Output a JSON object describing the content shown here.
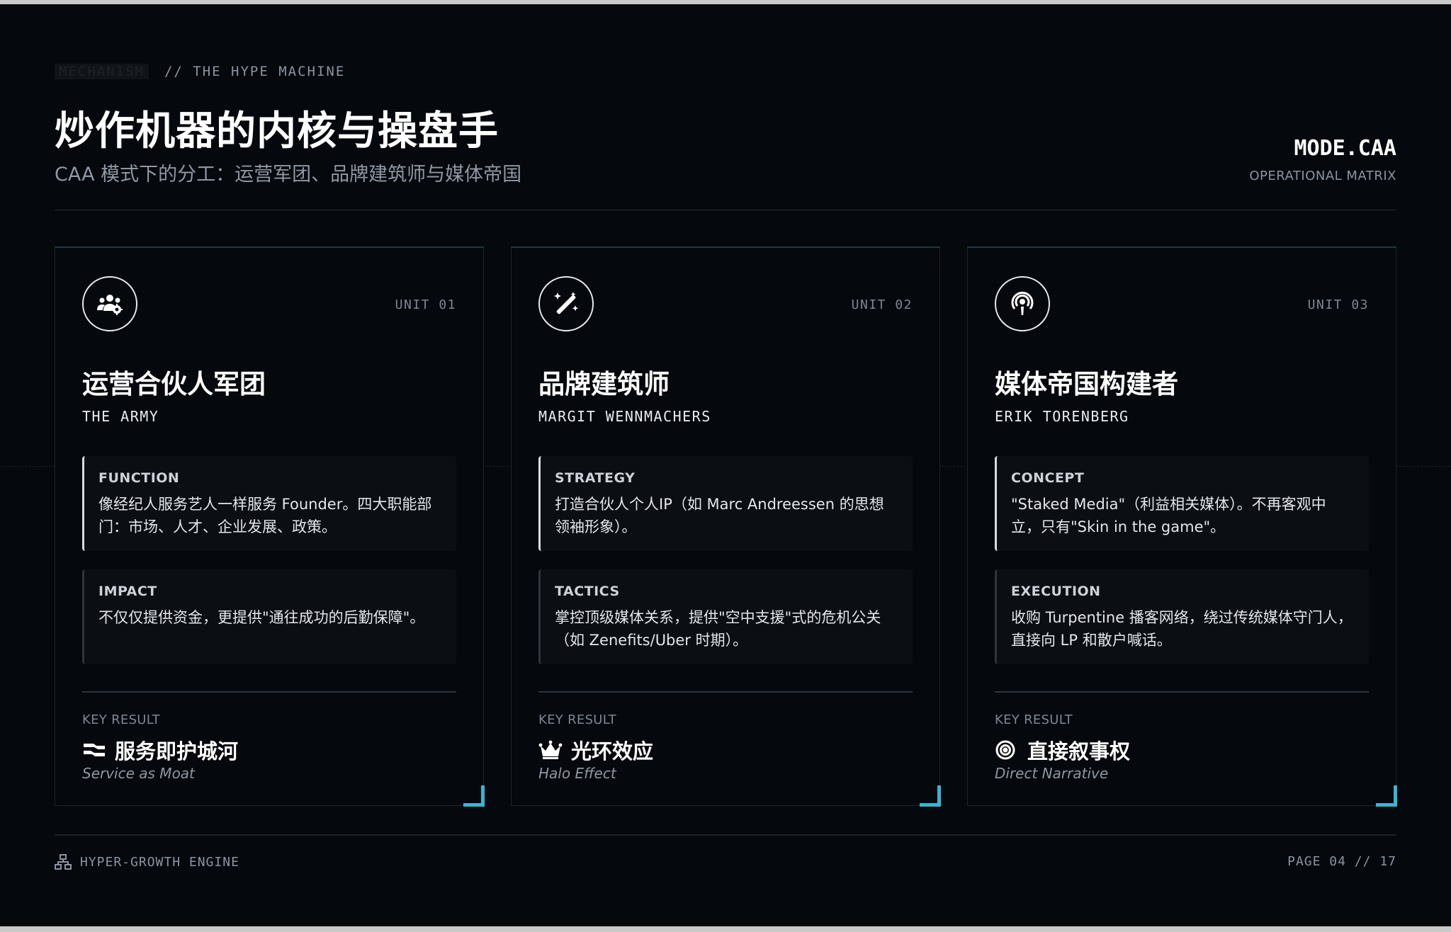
{
  "header": {
    "tag": "MECHANISM",
    "eyebrow": "// THE HYPE MACHINE",
    "title": "炒作机器的内核与操盘手",
    "subtitle": "CAA 模式下的分工：运营军团、品牌建筑师与媒体帝国",
    "mode": "MODE.CAA",
    "mode_sub": "OPERATIONAL MATRIX"
  },
  "cards": [
    {
      "icon": "users-gear-icon",
      "unit": "UNIT 01",
      "title": "运营合伙人军团",
      "subtitle": "THE ARMY",
      "blocks": [
        {
          "label": "FUNCTION",
          "text": "像经纪人服务艺人一样服务 Founder。四大职能部门：市场、人才、企业发展、政策。"
        },
        {
          "label": "IMPACT",
          "text": "不仅仅提供资金，更提供\"通往成功的后勤保障\"。"
        }
      ],
      "kr_label": "KEY RESULT",
      "kr_icon": "handshake-icon",
      "kr_title": "服务即护城河",
      "kr_en": "Service as Moat"
    },
    {
      "icon": "magic-wand-icon",
      "unit": "UNIT 02",
      "title": "品牌建筑师",
      "subtitle": "MARGIT WENNMACHERS",
      "blocks": [
        {
          "label": "STRATEGY",
          "text": "打造合伙人个人IP（如 Marc Andreessen 的思想领袖形象）。"
        },
        {
          "label": "TACTICS",
          "text": "掌控顶级媒体关系，提供\"空中支援\"式的危机公关（如 Zenefits/Uber 时期）。"
        }
      ],
      "kr_label": "KEY RESULT",
      "kr_icon": "crown-icon",
      "kr_title": "光环效应",
      "kr_en": "Halo Effect"
    },
    {
      "icon": "podcast-icon",
      "unit": "UNIT 03",
      "title": "媒体帝国构建者",
      "subtitle": "ERIK TORENBERG",
      "blocks": [
        {
          "label": "CONCEPT",
          "text": "\"Staked Media\"（利益相关媒体）。不再客观中立，只有\"Skin in the game\"。"
        },
        {
          "label": "EXECUTION",
          "text": "收购 Turpentine 播客网络，绕过传统媒体守门人，直接向 LP 和散户喊话。"
        }
      ],
      "kr_label": "KEY RESULT",
      "kr_icon": "bullseye-icon",
      "kr_title": "直接叙事权",
      "kr_en": "Direct Narrative"
    }
  ],
  "footer": {
    "icon": "sitemap-icon",
    "left": "HYPER-GROWTH ENGINE",
    "right": "PAGE 04 // 17"
  },
  "colors": {
    "background": "#05080d",
    "accent": "#35b6d2",
    "text": "#ffffff",
    "muted": "#8a94a1"
  }
}
